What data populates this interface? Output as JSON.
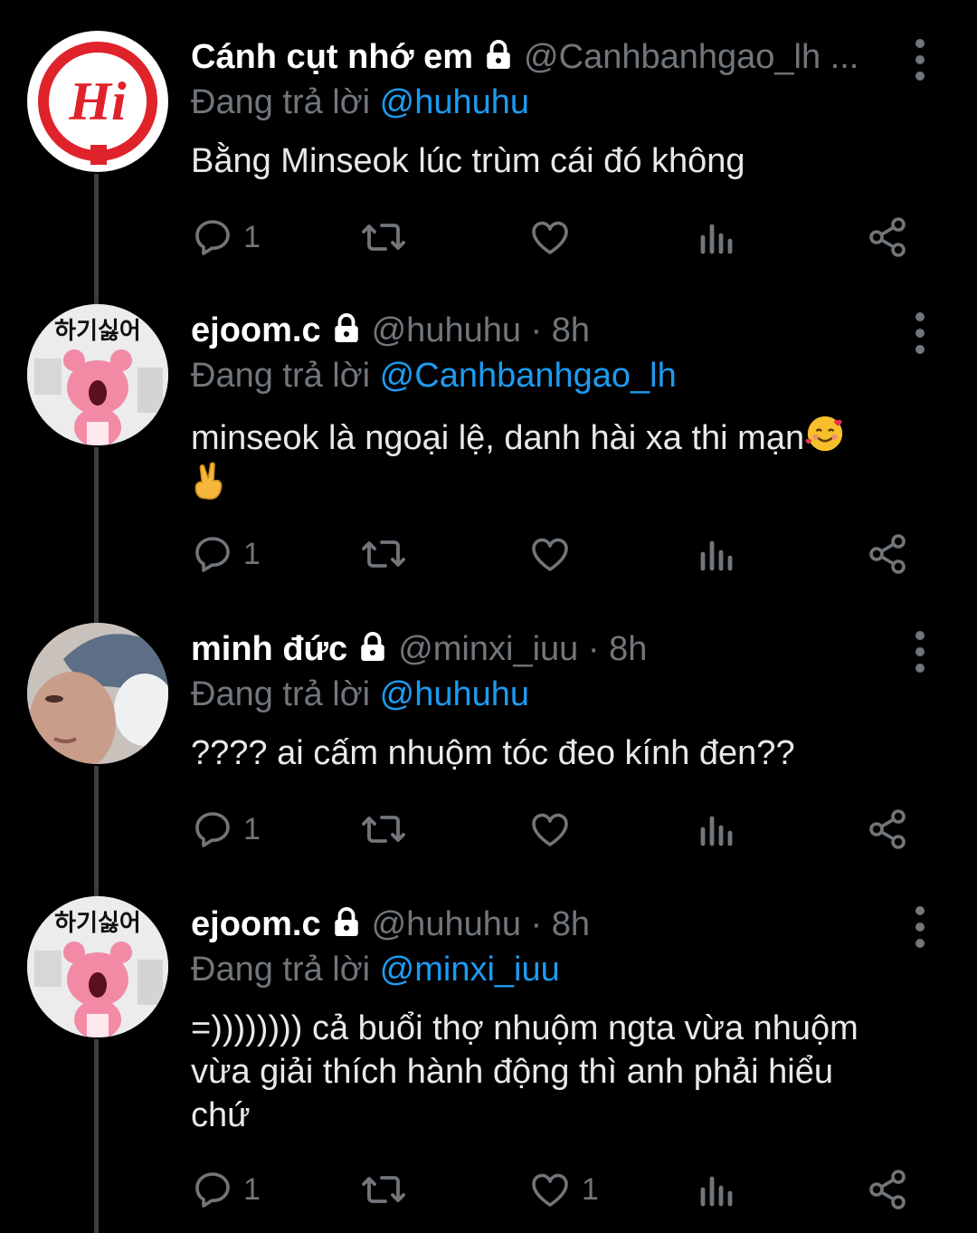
{
  "reply_prefix": "Đang trả lời ",
  "tweets": [
    {
      "name": "Cánh cụt nhớ em",
      "handle": "@Canhbanhgao_lh ...",
      "time": "",
      "reply_to": "@huhuhu",
      "text": "Bằng Minseok lúc trùm cái đó không",
      "avatar_text": "Hi",
      "replies": "1",
      "likes": ""
    },
    {
      "name": "ejoom.c",
      "handle": "@huhuhu",
      "time": " · 8h",
      "reply_to": "@Canhbanhgao_lh",
      "text": "minseok là ngoại lệ, danh hài xa thi mạn",
      "avatar_text": "하기싫어",
      "replies": "1",
      "likes": ""
    },
    {
      "name": "minh đức",
      "handle": "@minxi_iuu",
      "time": " · 8h",
      "reply_to": "@huhuhu",
      "text": "???? ai cấm nhuộm tóc đeo kính đen??",
      "avatar_text": "",
      "replies": "1",
      "likes": ""
    },
    {
      "name": "ejoom.c",
      "handle": "@huhuhu",
      "time": " · 8h",
      "reply_to": "@minxi_iuu",
      "text": "=)))))))) cả buổi thợ nhuộm ngta vừa nhuộm\nvừa giải thích hành động thì anh phải hiểu\nchứ",
      "avatar_text": "하기싫어",
      "replies": "1",
      "likes": "1"
    }
  ],
  "colors": {
    "background": "#000000",
    "name": "#ffffff",
    "secondary": "#71767b",
    "mention": "#1d9bf0",
    "text": "#e7e9ea",
    "hi_red": "#e0222b"
  },
  "icons": [
    "lock-icon",
    "more-icon",
    "reply-icon",
    "retweet-icon",
    "like-icon",
    "views-icon",
    "share-icon",
    "emoji-smiling-hearts",
    "emoji-crossed-fingers"
  ]
}
